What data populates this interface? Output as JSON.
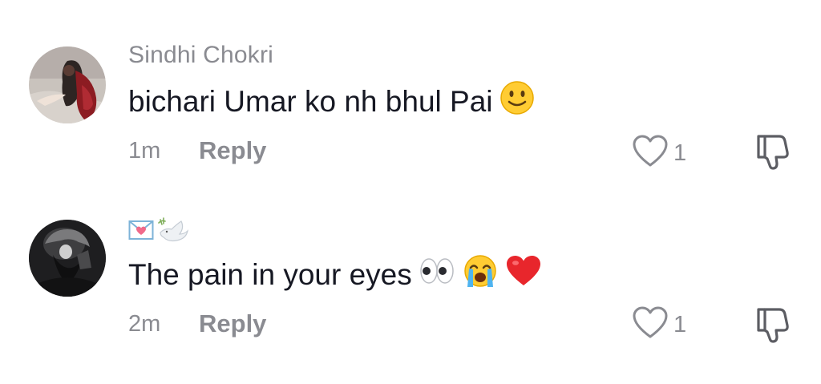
{
  "comments": [
    {
      "username": "Sindhi Chokri",
      "text": "bichari Umar ko nh bhul Pai",
      "text_emojis": [
        "slightly-smiling-face"
      ],
      "time": "1m",
      "reply_label": "Reply",
      "like_count": "1"
    },
    {
      "username": "",
      "username_emojis": [
        "love-letter",
        "dove"
      ],
      "text": "The pain in your eyes",
      "text_emojis": [
        "eyes",
        "loudly-crying-face",
        "red-heart"
      ],
      "time": "2m",
      "reply_label": "Reply",
      "like_count": "1"
    }
  ],
  "colors": {
    "primary_text": "#161823",
    "secondary_text": "#8a8b91",
    "background": "#ffffff",
    "heart_red": "#e8262c",
    "emoji_yellow": "#ffcc33"
  }
}
